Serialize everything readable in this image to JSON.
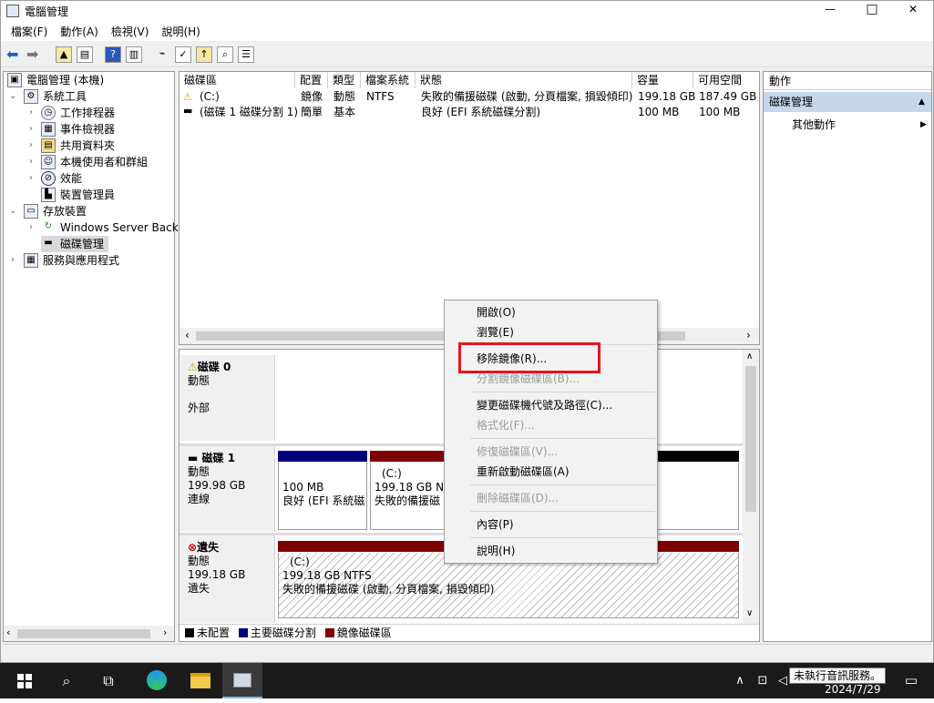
{
  "window": {
    "title": "電腦管理",
    "min": "—",
    "max": "□",
    "close": "✕"
  },
  "menu": [
    "檔案(F)",
    "動作(A)",
    "檢視(V)",
    "說明(H)"
  ],
  "tree": {
    "root": "電腦管理 (本機)",
    "system_tools": "系統工具",
    "task_scheduler": "工作排程器",
    "event_viewer": "事件檢視器",
    "shared_folders": "共用資料夾",
    "local_users": "本機使用者和群組",
    "performance": "效能",
    "device_manager": "裝置管理員",
    "storage": "存放裝置",
    "wsb": "Windows Server Backu",
    "disk_mgmt": "磁碟管理",
    "services": "服務與應用程式"
  },
  "volume_table": {
    "headers": [
      "磁碟區",
      "配置",
      "類型",
      "檔案系統",
      "狀態",
      "容量",
      "可用空間"
    ],
    "rows": [
      [
        "(C:)",
        "鏡像",
        "動態",
        "NTFS",
        "失敗的備援磁碟 (啟動, 分頁檔案, 損毀傾印)",
        "199.18 GB",
        "187.49 GB"
      ],
      [
        "(磁碟 1 磁碟分割 1)",
        "簡單",
        "基本",
        "",
        "良好 (EFI 系統磁碟分割)",
        "100 MB",
        "100 MB"
      ]
    ]
  },
  "disks": {
    "disk0": {
      "name": "磁碟 0",
      "type": "動態",
      "status": "外部"
    },
    "disk1": {
      "name": "磁碟 1",
      "type": "動態",
      "size": "199.98 GB",
      "status": "連線",
      "p1": {
        "size": "100 MB",
        "status": "良好 (EFI 系統磁"
      },
      "p2": {
        "label": "(C:)",
        "size": "199.18 GB NT",
        "status": "失敗的備援磁"
      }
    },
    "missing": {
      "name": "遺失",
      "type": "動態",
      "size": "199.18 GB",
      "status": "遺失",
      "vol": {
        "label": "(C:)",
        "size": "199.18 GB NTFS",
        "status": "失敗的備援磁碟 (啟動, 分頁檔案, 損毀傾印)"
      }
    }
  },
  "legend": [
    "未配置",
    "主要磁碟分割",
    "鏡像磁碟區"
  ],
  "actions": {
    "header": "動作",
    "section": "磁碟管理",
    "more": "其他動作"
  },
  "context_menu": {
    "open": "開啟(O)",
    "explore": "瀏覽(E)",
    "remove_mirror": "移除鏡像(R)...",
    "split_mirror": "分割鏡像磁碟區(B)...",
    "change_letter": "變更磁碟機代號及路徑(C)...",
    "format": "格式化(F)...",
    "repair": "修復磁碟區(V)...",
    "reactivate": "重新啟動磁碟區(A)",
    "delete": "刪除磁碟區(D)...",
    "properties": "內容(P)",
    "help": "說明(H)"
  },
  "taskbar": {
    "tooltip": "未執行音訊服務。",
    "date": "2024/7/29"
  },
  "colors": {
    "unallocated": "#000000",
    "primary": "#00007f",
    "mirror": "#7f0000",
    "highlight": "#e8141a"
  }
}
